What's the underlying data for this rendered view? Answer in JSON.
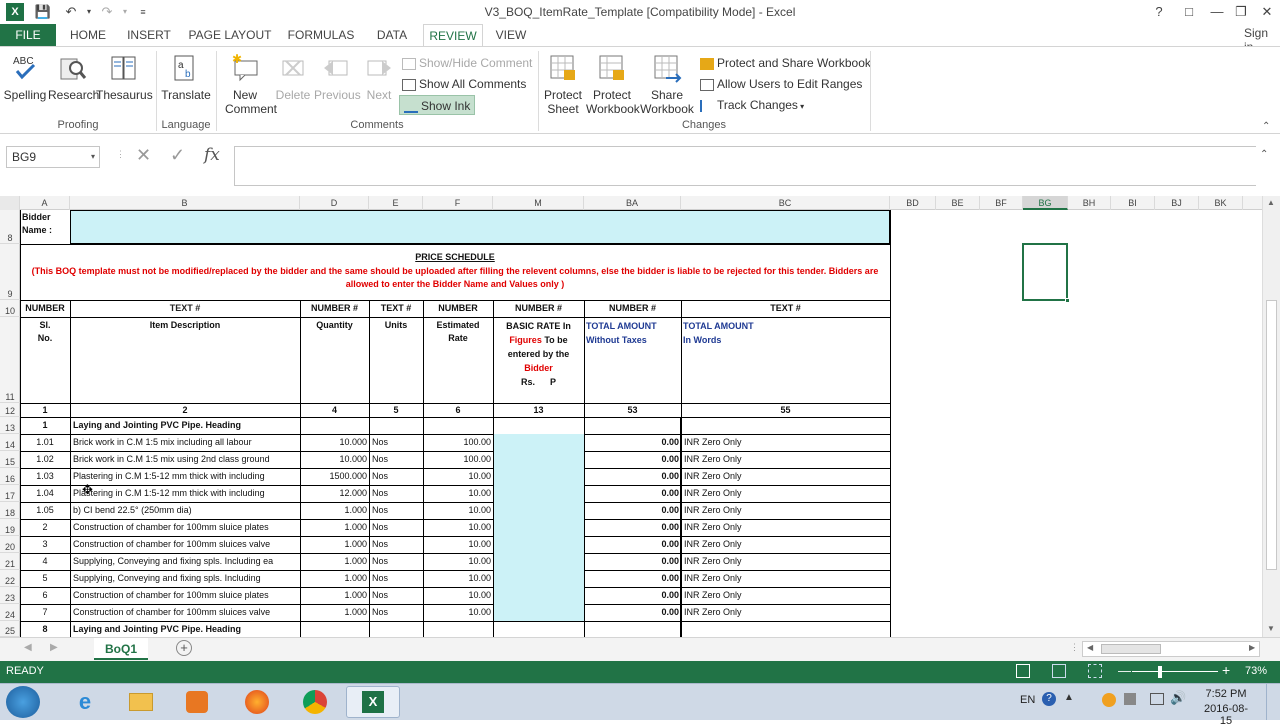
{
  "window": {
    "title": "V3_BOQ_ItemRate_Template  [Compatibility Mode] - Excel",
    "sign_in": "Sign in"
  },
  "tabs": [
    "FILE",
    "HOME",
    "INSERT",
    "PAGE LAYOUT",
    "FORMULAS",
    "DATA",
    "REVIEW",
    "VIEW"
  ],
  "ribbon": {
    "proofing": {
      "spelling": "Spelling",
      "research": "Research",
      "thesaurus": "Thesaurus",
      "label": "Proofing"
    },
    "language": {
      "translate": "Translate",
      "label": "Language"
    },
    "comments": {
      "new_comment": "New Comment",
      "delete": "Delete",
      "previous": "Previous",
      "next": "Next",
      "show_hide": "Show/Hide Comment",
      "show_all": "Show All Comments",
      "show_ink": "Show Ink",
      "label": "Comments"
    },
    "changes": {
      "protect_sheet": "Protect Sheet",
      "protect_workbook": "Protect Workbook",
      "share_workbook": "Share Workbook",
      "protect_share": "Protect and Share Workbook",
      "allow_users": "Allow Users to Edit Ranges",
      "track_changes": "Track Changes",
      "label": "Changes"
    }
  },
  "formula_bar": {
    "name_box": "BG9",
    "fx": "fx",
    "content": ""
  },
  "columns": [
    "A",
    "B",
    "D",
    "E",
    "F",
    "M",
    "BA",
    "BC",
    "BD",
    "BE",
    "BF",
    "BG",
    "BH",
    "BI",
    "BJ",
    "BK"
  ],
  "selected_column": "BG",
  "rows": [
    "8",
    "9",
    "10",
    "11",
    "12",
    "13",
    "14",
    "15",
    "16",
    "17",
    "18",
    "19",
    "20",
    "21",
    "22",
    "23",
    "24",
    "25"
  ],
  "sheet": {
    "bidder_label": "Bidder Name :",
    "price_schedule": "PRICE SCHEDULE",
    "warning": "(This BOQ template must not be modified/replaced by the bidder and the same should be uploaded after filling the relevent columns, else the bidder is liable to be rejected for this tender. Bidders are allowed to enter the Bidder Name and Values only )",
    "types": [
      "NUMBER",
      "TEXT #",
      "NUMBER #",
      "TEXT #",
      "NUMBER",
      "NUMBER #",
      "NUMBER #",
      "TEXT #"
    ],
    "headers": {
      "sl": "Sl.\nNo.",
      "desc": "Item Description",
      "qty": "Quantity",
      "units": "Units",
      "est": "Estimated\nRate",
      "basic_1": "BASIC RATE In",
      "basic_2": "Figures",
      "basic_3": " To be",
      "basic_4": "entered by the",
      "basic_5": "Bidder",
      "basic_6": "Rs.      P",
      "total": "TOTAL AMOUNT\nWithout Taxes",
      "words": "TOTAL AMOUNT\nIn Words"
    },
    "numbers": [
      "1",
      "2",
      "4",
      "5",
      "6",
      "13",
      "53",
      "55"
    ],
    "items": [
      {
        "sl": "1",
        "desc": "Laying and Jointing PVC Pipe. Heading",
        "qty": "",
        "unit": "",
        "rate": "",
        "total": "",
        "words": "",
        "bold": true
      },
      {
        "sl": "1.01",
        "desc": "Brick work in C.M 1:5 mix including all labour",
        "qty": "10.000",
        "unit": "Nos",
        "rate": "100.00",
        "total": "0.00",
        "words": "INR Zero Only"
      },
      {
        "sl": "1.02",
        "desc": "Brick work in C.M 1:5 mix using 2nd class ground",
        "qty": "10.000",
        "unit": "Nos",
        "rate": "100.00",
        "total": "0.00",
        "words": "INR Zero Only"
      },
      {
        "sl": "1.03",
        "desc": "Plastering in C.M 1:5-12 mm thick with including",
        "qty": "1500.000",
        "unit": "Nos",
        "rate": "10.00",
        "total": "0.00",
        "words": "INR Zero Only"
      },
      {
        "sl": "1.04",
        "desc": "Plastering in C.M 1:5-12 mm thick with including",
        "qty": "12.000",
        "unit": "Nos",
        "rate": "10.00",
        "total": "0.00",
        "words": "INR Zero Only"
      },
      {
        "sl": "1.05",
        "desc": "b)  CI bend 22.5° (250mm dia)",
        "qty": "1.000",
        "unit": "Nos",
        "rate": "10.00",
        "total": "0.00",
        "words": "INR Zero Only"
      },
      {
        "sl": "2",
        "desc": "Construction of chamber for 100mm sluice plates",
        "qty": "1.000",
        "unit": "Nos",
        "rate": "10.00",
        "total": "0.00",
        "words": "INR Zero Only"
      },
      {
        "sl": "3",
        "desc": "Construction of chamber for 100mm sluices valve",
        "qty": "1.000",
        "unit": "Nos",
        "rate": "10.00",
        "total": "0.00",
        "words": "INR Zero Only"
      },
      {
        "sl": "4",
        "desc": "Supplying, Conveying and fixing spls. Including ea",
        "qty": "1.000",
        "unit": "Nos",
        "rate": "10.00",
        "total": "0.00",
        "words": "INR Zero Only"
      },
      {
        "sl": "5",
        "desc": "Supplying, Conveying and fixing spls. Including",
        "qty": "1.000",
        "unit": "Nos",
        "rate": "10.00",
        "total": "0.00",
        "words": "INR Zero Only"
      },
      {
        "sl": "6",
        "desc": "Construction of chamber for 100mm sluice plates",
        "qty": "1.000",
        "unit": "Nos",
        "rate": "10.00",
        "total": "0.00",
        "words": "INR Zero Only"
      },
      {
        "sl": "7",
        "desc": "Construction of chamber for 100mm sluices valve",
        "qty": "1.000",
        "unit": "Nos",
        "rate": "10.00",
        "total": "0.00",
        "words": "INR Zero Only"
      },
      {
        "sl": "8",
        "desc": "Laying and Jointing PVC Pipe. Heading",
        "qty": "",
        "unit": "",
        "rate": "",
        "total": "",
        "words": "",
        "bold": true
      }
    ]
  },
  "sheet_tab": "BoQ1",
  "status": {
    "ready": "READY",
    "zoom": "73%"
  },
  "taskbar": {
    "lang": "EN",
    "time": "7:52 PM",
    "date": "2016-08-15"
  },
  "colors": {
    "excel_green": "#217346",
    "cyan_fill": "#ccf2f7",
    "warning_red": "#e00000",
    "blue_text": "#1f3a93"
  }
}
